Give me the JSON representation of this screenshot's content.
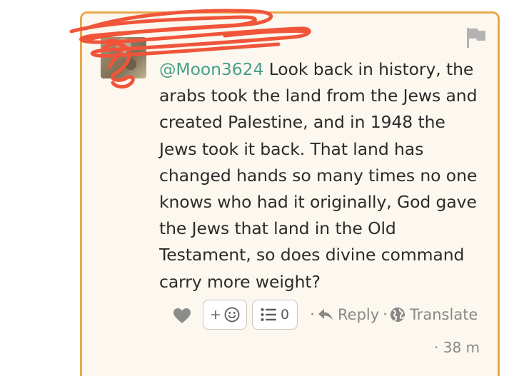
{
  "post": {
    "mention": "@Moon3624",
    "body": " Look back in history, the arabs took the land from the Jews and created Palestine, and in 1948 the Jews took it back. That land has changed hands so many times no one knows who had it originally, God gave the Jews that land in the Old Testament, so does divine command carry more weight?"
  },
  "actions": {
    "react_label": "+",
    "list_count": "0",
    "reply_label": "Reply",
    "translate_label": "Translate",
    "separator": "·"
  },
  "meta": {
    "time": "· 38 m"
  },
  "colors": {
    "border": "#e9a84c",
    "card_bg": "#fcf8ef",
    "mention": "#4a9f8c",
    "scribble": "#f0553a"
  },
  "icons": [
    "flag-icon",
    "heart-icon",
    "smiley-icon",
    "list-icon",
    "reply-arrow-icon",
    "globe-icon"
  ]
}
